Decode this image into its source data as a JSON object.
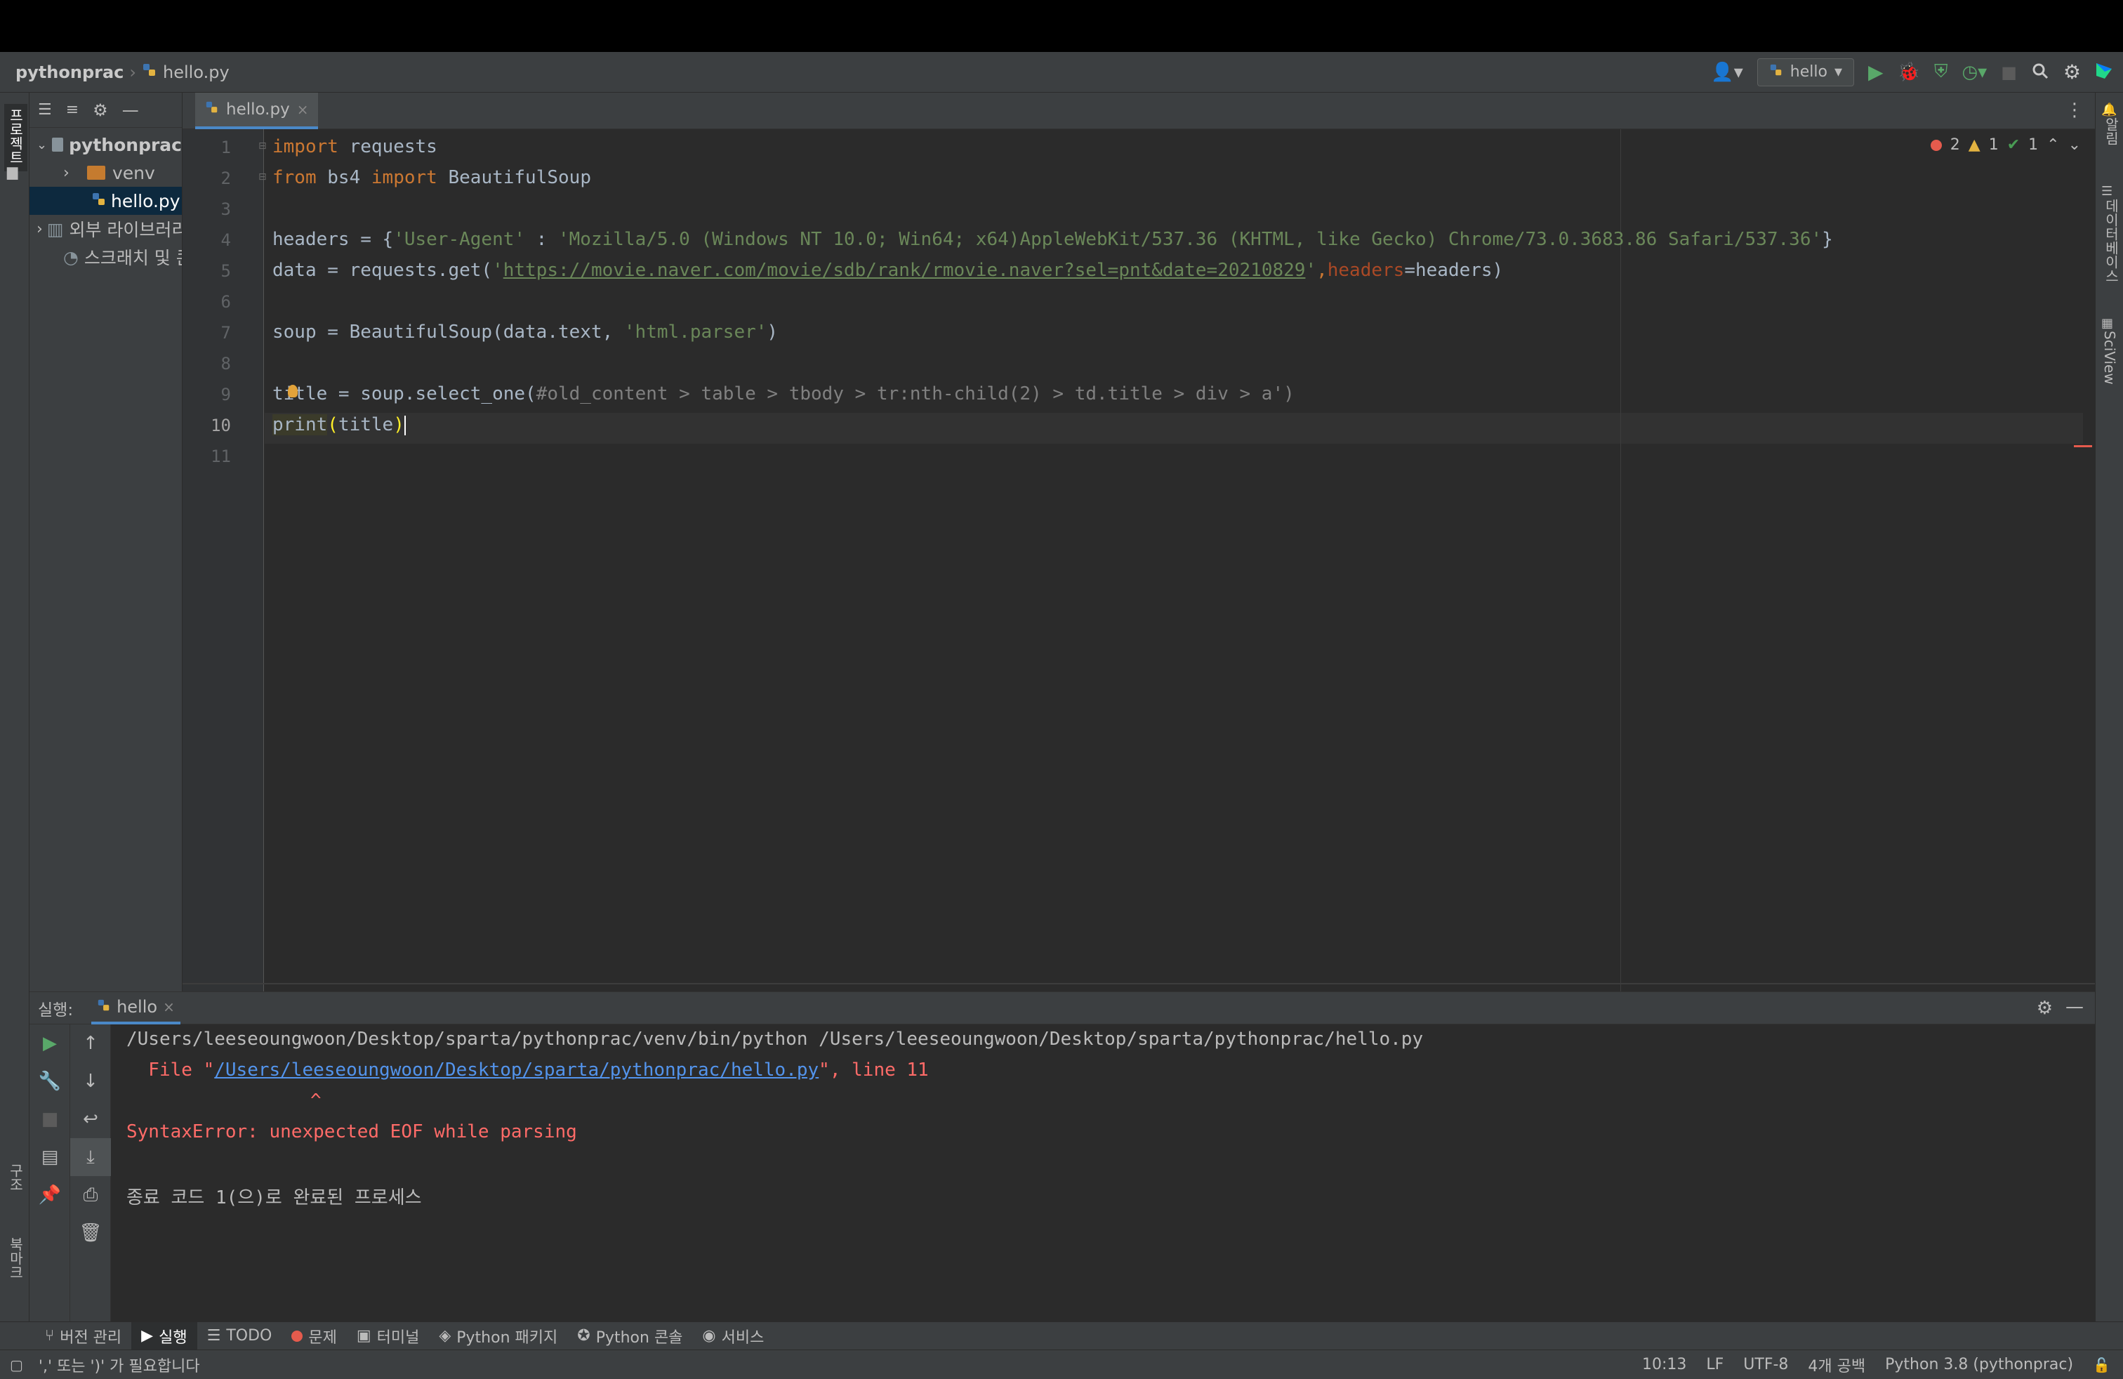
{
  "breadcrumb": {
    "project": "pythonprac",
    "file": "hello.py"
  },
  "run_config": {
    "name": "hello"
  },
  "colors": {
    "run": "#59a869",
    "debug": "#ecbd4b",
    "error": "#e55b4d",
    "warning": "#e3b341",
    "ok": "#499c54",
    "accent": "#4a88c7"
  },
  "left_strip": {
    "project_label": "프로젝트",
    "structure_label": "구조",
    "bookmarks_label": "북마크"
  },
  "right_strip": {
    "notifications_label": "알림",
    "database_label": "데이터베이스",
    "sciview_label": "SciView"
  },
  "project_tree": {
    "root": "pythonprac",
    "venv": "venv",
    "file": "hello.py",
    "external_libs": "외부 라이브러리",
    "scratches": "스크래치 및 콘솔"
  },
  "editor": {
    "tab": "hello.py",
    "inspection": {
      "errors": "2",
      "warnings": "1",
      "ok": "1"
    },
    "line_numbers": [
      "1",
      "2",
      "3",
      "4",
      "5",
      "6",
      "7",
      "8",
      "9",
      "10",
      "11"
    ],
    "code": {
      "l1_kw": "import",
      "l1_rest": " requests",
      "l2_kw1": "from",
      "l2_mid": " bs4 ",
      "l2_kw2": "import",
      "l2_rest": " BeautifulSoup",
      "l4_a": "headers = {",
      "l4_key": "'User-Agent'",
      "l4_b": " : ",
      "l4_val": "'Mozilla/5.0 (Windows NT 10.0; Win64; x64)AppleWebKit/537.36 (KHTML, like Gecko) Chrome/73.0.3683.86 Safari/537.36'",
      "l4_c": "}",
      "l5_a": "data = requests.get(",
      "l5_q1": "'",
      "l5_url": "https://movie.naver.com/movie/sdb/rank/rmovie.naver?sel=pnt&date=20210829",
      "l5_q2": "'",
      "l5_comma": ",",
      "l5_param": "headers",
      "l5_b": "=headers)",
      "l7_a": "soup = BeautifulSoup(data.text, ",
      "l7_str": "'html.parser'",
      "l7_b": ")",
      "l9_a": "title = soup.select_one(",
      "l9_b": "#old_content > table > tbody > tr:nth-child(2) > td.title > div > a')",
      "l10_fn": "print",
      "l10_open": "(",
      "l10_arg": "title",
      "l10_close": ")"
    }
  },
  "run_panel": {
    "label": "실행:",
    "tab": "hello",
    "output": {
      "cmd": "/Users/leeseoungwoon/Desktop/sparta/pythonprac/venv/bin/python /Users/leeseoungwoon/Desktop/sparta/pythonprac/hello.py",
      "file_prefix": "  File \"",
      "file_link": "/Users/leeseoungwoon/Desktop/sparta/pythonprac/hello.py",
      "file_suffix": "\", line 11",
      "caret": "^",
      "error": "SyntaxError: unexpected EOF while parsing",
      "exit": "종료 코드 1(으)로 완료된 프로세스"
    }
  },
  "bottom_tabs": [
    "버전 관리",
    "실행",
    "TODO",
    "문제",
    "터미널",
    "Python 패키지",
    "Python 콘솔",
    "서비스"
  ],
  "status": {
    "message": "',' 또는 ')' 가 필요합니다",
    "position": "10:13",
    "line_sep": "LF",
    "encoding": "UTF-8",
    "indent": "4개 공백",
    "interpreter": "Python 3.8 (pythonprac)"
  }
}
